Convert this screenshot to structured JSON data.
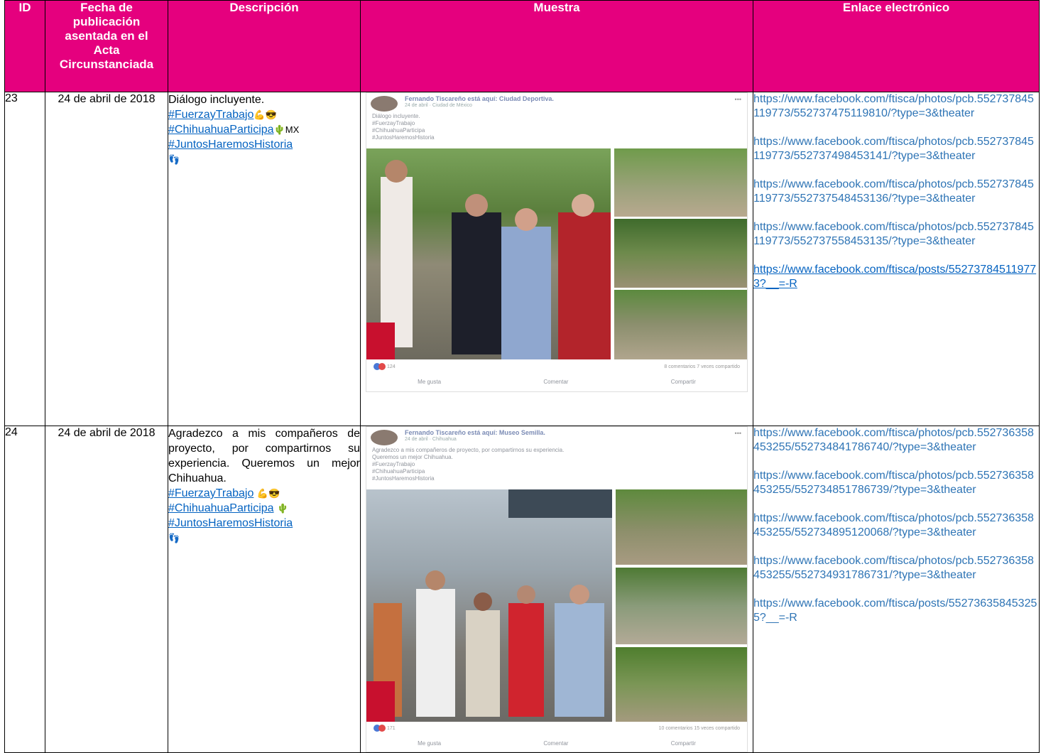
{
  "headers": {
    "id": "ID",
    "fecha": "Fecha de publicación asentada en el Acta Circunstanciada",
    "descripcion": "Descripción",
    "muestra": "Muestra",
    "enlace": "Enlace electrónico"
  },
  "rows": [
    {
      "id": "23",
      "fecha": "24 de abril de 2018",
      "descripcion": "Diálogo incluyente.",
      "hashtags": [
        "#FuerzayTrabajo",
        "#ChihuahuaParticipa",
        "#JuntosHaremosHistoria"
      ],
      "mx": "MX",
      "post": {
        "author": "Fernando Tiscareño está aquí: Ciudad Deportiva.",
        "sub": "24 de abril · Ciudad de México",
        "text_lines": [
          "Diálogo incluyente.",
          "#FuerzayTrabajo",
          "#ChihuahuaParticipa",
          "#JuntosHaremosHistoria"
        ],
        "likes": "124",
        "meta": "8 comentarios  7 veces compartido",
        "actions": [
          "Me gusta",
          "Comentar",
          "Compartir"
        ]
      },
      "links": [
        "https://www.facebook.com/ftisca/photos/pcb.552737845119773/552737475119810/?type=3&theater",
        "https://www.facebook.com/ftisca/photos/pcb.552737845119773/552737498453141/?type=3&theater",
        "https://www.facebook.com/ftisca/photos/pcb.552737845119773/552737548453136/?type=3&theater",
        "https://www.facebook.com/ftisca/photos/pcb.552737845119773/552737558453135/?type=3&theater",
        "https://www.facebook.com/ftisca/posts/552737845119773?__=-R"
      ]
    },
    {
      "id": "24",
      "fecha": "24 de abril de 2018",
      "descripcion": "Agradezco a mis compañeros de proyecto, por compartirnos su experiencia. Queremos un mejor Chihuahua.",
      "hashtags": [
        "#FuerzayTrabajo",
        "#ChihuahuaParticipa",
        "#JuntosHaremosHistoria"
      ],
      "post": {
        "author": "Fernando Tiscareño está aquí: Museo Semilla.",
        "sub": "24 de abril · Chihuahua",
        "text_lines": [
          "Agradezco a mis compañeros de proyecto, por compartirnos su experiencia.",
          "Queremos un mejor Chihuahua.",
          "#FuerzayTrabajo",
          "#ChihuahuaParticipa",
          "#JuntosHaremosHistoria"
        ],
        "likes": "171",
        "meta": "10 comentarios  15 veces compartido",
        "actions": [
          "Me gusta",
          "Comentar",
          "Compartir"
        ]
      },
      "links": [
        "https://www.facebook.com/ftisca/photos/pcb.552736358453255/552734841786740/?type=3&theater",
        "https://www.facebook.com/ftisca/photos/pcb.552736358453255/552734851786739/?type=3&theater",
        "https://www.facebook.com/ftisca/photos/pcb.552736358453255/552734895120068/?type=3&theater",
        "https://www.facebook.com/ftisca/photos/pcb.552736358453255/552734931786731/?type=3&theater",
        "https://www.facebook.com/ftisca/posts/552736358453255?__=-R"
      ]
    }
  ]
}
